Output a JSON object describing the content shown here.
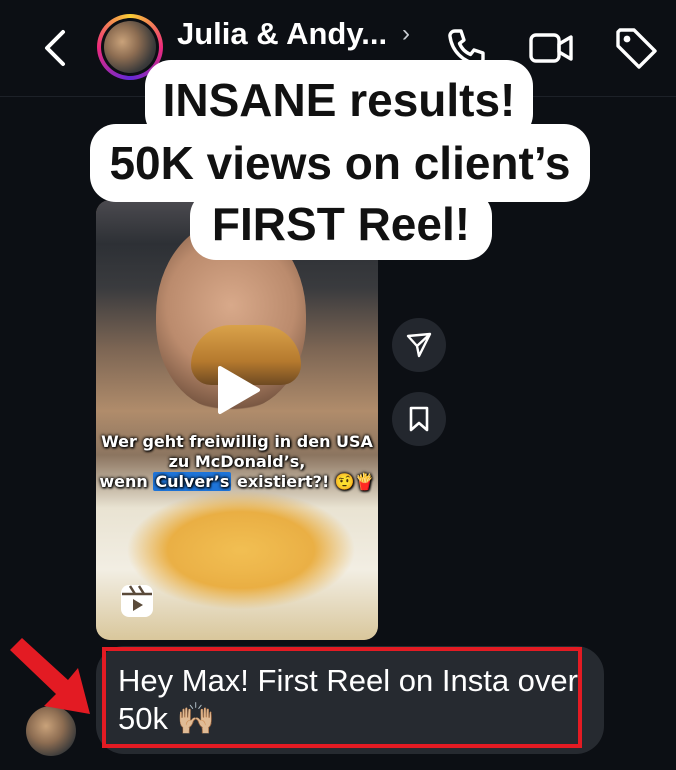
{
  "header": {
    "contact_name": "Julia & Andy...",
    "chevron": "›",
    "subtitle": "",
    "icons": [
      "back-arrow-icon",
      "phone-icon",
      "video-camera-icon",
      "tag-icon"
    ]
  },
  "caption": {
    "line1": "INSANE results!",
    "line2": "50K views on client’s",
    "line3": "FIRST Reel!"
  },
  "reel": {
    "text_line1": "Wer geht freiwillig in den USA",
    "text_line2": "zu McDonald’s,",
    "text_line3_pre": "wenn ",
    "text_line3_hl": "Culver’s",
    "text_line3_post": " existiert?! 🤨🍟",
    "colors": {
      "highlight": "#1e74d8"
    }
  },
  "side_actions": [
    "share-icon",
    "bookmark-icon"
  ],
  "message": {
    "text": "Hey Max! First Reel on Insta over 50k 🙌🏼"
  },
  "colors": {
    "background": "#0c0f14",
    "bubble": "#262a30",
    "highlight_border": "#e31b23",
    "arrow": "#e31b23"
  }
}
